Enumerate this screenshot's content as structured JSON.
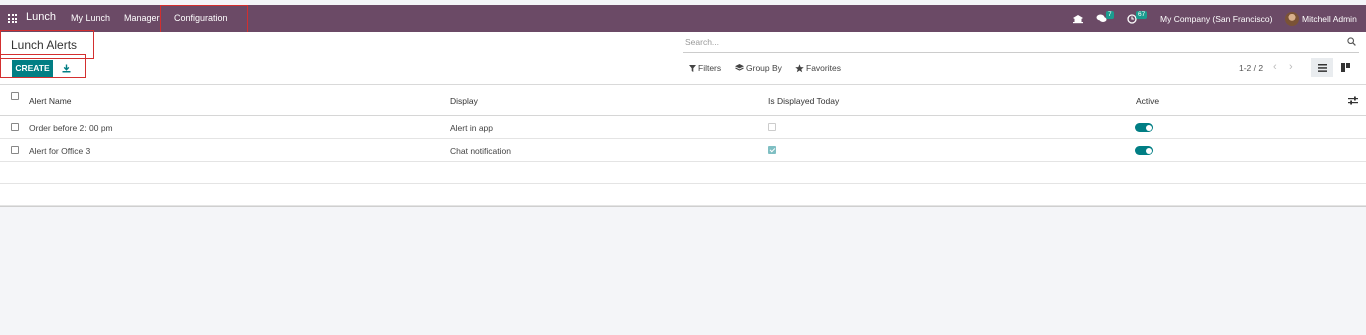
{
  "navbar": {
    "app_name": "Lunch",
    "menu": [
      "My Lunch",
      "Manager",
      "Configuration"
    ],
    "messages_count": "7",
    "activities_count": "67",
    "company": "My Company (San Francisco)",
    "user": "Mitchell Admin"
  },
  "control": {
    "title": "Lunch Alerts",
    "create_label": "CREATE",
    "search_placeholder": "Search...",
    "filters_label": "Filters",
    "group_by_label": "Group By",
    "favorites_label": "Favorites",
    "pager": "1-2 / 2"
  },
  "table": {
    "columns": [
      "Alert Name",
      "Display",
      "Is Displayed Today",
      "Active"
    ],
    "rows": [
      {
        "name": "Order before 2: 00 pm",
        "display": "Alert in app",
        "displayed_today": false,
        "active": true
      },
      {
        "name": "Alert for Office 3",
        "display": "Chat notification",
        "displayed_today": true,
        "active": true
      }
    ]
  },
  "colors": {
    "navbar": "#6b4a66",
    "primary": "#017e84",
    "highlight": "#d32f2f"
  }
}
